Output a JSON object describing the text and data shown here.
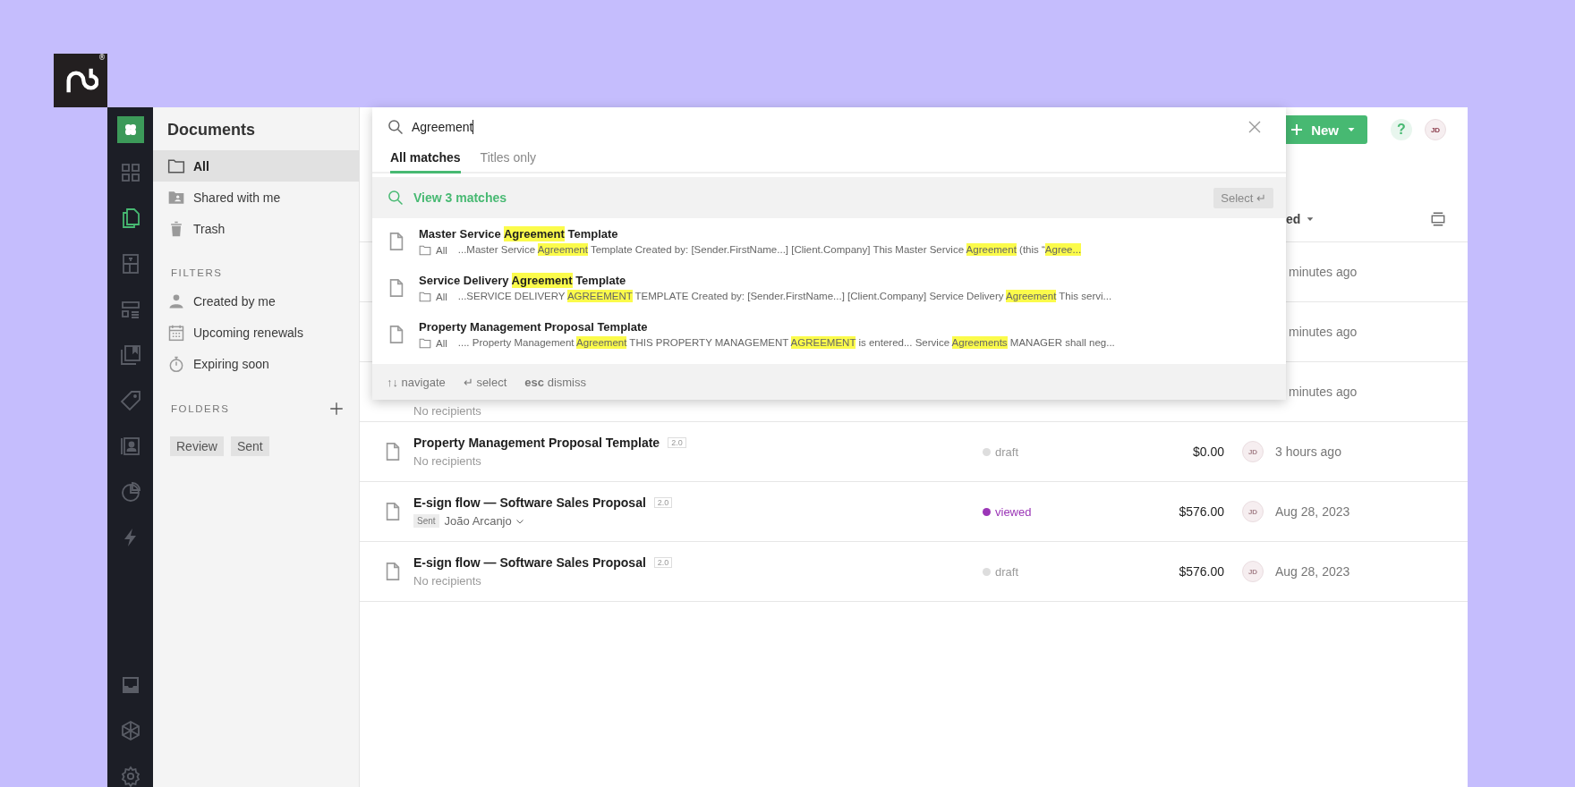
{
  "brand": {
    "registered_mark": "®"
  },
  "rail": {
    "items": [
      {
        "selected": false
      },
      {
        "selected": true
      },
      {
        "selected": false
      },
      {
        "selected": false
      },
      {
        "selected": false
      },
      {
        "selected": false
      },
      {
        "selected": false
      },
      {
        "selected": false
      },
      {
        "selected": false
      }
    ],
    "bottom_items": [
      {
        "selected": false
      },
      {
        "selected": false
      },
      {
        "selected": false
      }
    ]
  },
  "sidebar": {
    "title": "Documents",
    "items": [
      {
        "label": "All",
        "selected": true
      },
      {
        "label": "Shared with me",
        "selected": false
      },
      {
        "label": "Trash",
        "selected": false
      }
    ],
    "filters_heading": "FILTERS",
    "filters": [
      "Created by me",
      "Upcoming renewals",
      "Expiring soon"
    ],
    "folders_heading": "FOLDERS",
    "folder_tags": [
      "Review",
      "Sent"
    ]
  },
  "toolbar": {
    "new_button": "New",
    "help": "?",
    "avatar": "JD"
  },
  "table": {
    "sort_label": "ed",
    "rows": [
      {
        "date": "minutes ago"
      },
      {
        "date": "minutes ago"
      },
      {
        "recipients": "No recipients",
        "date": "minutes ago"
      },
      {
        "title": "Property Management Proposal Template",
        "version": "2.0",
        "recipients": "No recipients",
        "status": {
          "label": "draft",
          "color": "#dddddd"
        },
        "amount": "$0.00",
        "avatar": "JD",
        "date": "3 hours ago"
      },
      {
        "title": "E-sign flow — Software Sales Proposal",
        "version": "2.0",
        "sent_tag": "Sent",
        "recipient": "João Arcanjo",
        "status": {
          "label": "viewed",
          "color": "#9b36b7"
        },
        "amount": "$576.00",
        "avatar": "JD",
        "date": "Aug 28, 2023"
      },
      {
        "title": "E-sign flow — Software Sales Proposal",
        "version": "2.0",
        "recipients": "No recipients",
        "status": {
          "label": "draft",
          "color": "#dddddd"
        },
        "amount": "$576.00",
        "avatar": "JD",
        "date": "Aug 28, 2023"
      }
    ]
  },
  "search": {
    "query": "Agreement",
    "tabs": [
      {
        "label": "All matches",
        "selected": true
      },
      {
        "label": "Titles only",
        "selected": false
      }
    ],
    "view_all": "View 3 matches",
    "select_button": "Select ↵",
    "results": [
      {
        "title": [
          {
            "text": "Master Service ",
            "highlight": false
          },
          {
            "text": "Agreement",
            "highlight": true
          },
          {
            "text": " Template",
            "highlight": false
          }
        ],
        "location": "All",
        "snippet": [
          {
            "text": "...Master Service ",
            "highlight": false
          },
          {
            "text": "Agreement",
            "highlight": true
          },
          {
            "text": " Template Created by: [Sender.FirstName...]  [Client.Company] This Master Service ",
            "highlight": false
          },
          {
            "text": "Agreement",
            "highlight": true
          },
          {
            "text": " (this “",
            "highlight": false
          },
          {
            "text": "Agree...",
            "highlight": true
          }
        ]
      },
      {
        "title": [
          {
            "text": "Service Delivery ",
            "highlight": false
          },
          {
            "text": "Agreement",
            "highlight": true
          },
          {
            "text": " Template",
            "highlight": false
          }
        ],
        "location": "All",
        "snippet": [
          {
            "text": "...SERVICE DELIVERY ",
            "highlight": false
          },
          {
            "text": "AGREEMENT",
            "highlight": true
          },
          {
            "text": " TEMPLATE Created by: [Sender.FirstName...] [Client.Company] Service Delivery ",
            "highlight": false
          },
          {
            "text": "Agreement",
            "highlight": true
          },
          {
            "text": " This servi...",
            "highlight": false
          }
        ]
      },
      {
        "title": [
          {
            "text": "Property Management Proposal Template",
            "highlight": false
          }
        ],
        "location": "All",
        "snippet": [
          {
            "text": ".... Property Management ",
            "highlight": false
          },
          {
            "text": "Agreement",
            "highlight": true
          },
          {
            "text": " THIS PROPERTY MANAGEMENT ",
            "highlight": false
          },
          {
            "text": "AGREEMENT",
            "highlight": true
          },
          {
            "text": " is entered... Service ",
            "highlight": false
          },
          {
            "text": "Agreements",
            "highlight": true
          },
          {
            "text": " MANAGER shall neg...",
            "highlight": false
          }
        ]
      }
    ],
    "footer_hints": [
      "↑↓ navigate",
      "↵ select",
      "**esc** dismiss"
    ]
  }
}
